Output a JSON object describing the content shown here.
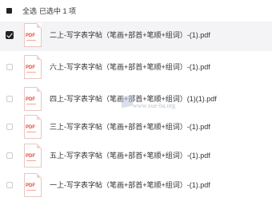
{
  "header": {
    "select_all_label": "全选",
    "selected_label": "已选中 1 项"
  },
  "files": [
    {
      "name": "二上-写字表字帖（笔画+部首+笔顺+组词）-(1).pdf",
      "selected": true,
      "icon_label": "PDF"
    },
    {
      "name": "六上-写字表字帖（笔画+部首+笔顺+组词）-(1).pdf",
      "selected": false,
      "icon_label": "PDF"
    },
    {
      "name": "四上-写字表字帖（笔画+部首+笔顺+组词）(1)(1).pdf",
      "selected": false,
      "icon_label": "PDF"
    },
    {
      "name": "三上-写字表字帖（笔画+部首+笔顺+组词）-(1).pdf",
      "selected": false,
      "icon_label": "PDF"
    },
    {
      "name": "五上-写字表字帖（笔画+部首+笔顺+组词）-(1).pdf",
      "selected": false,
      "icon_label": "PDF"
    },
    {
      "name": "一上-写字表字帖（笔画+部首+笔顺+组词）-(1).pdf",
      "selected": false,
      "icon_label": "PDF"
    }
  ],
  "watermark": {
    "text": "www.xue-ba.org"
  },
  "colors": {
    "selected_row_bg": "#f4f4f6",
    "pdf_red": "#e04a3a",
    "checkbox_checked": "#222222"
  }
}
